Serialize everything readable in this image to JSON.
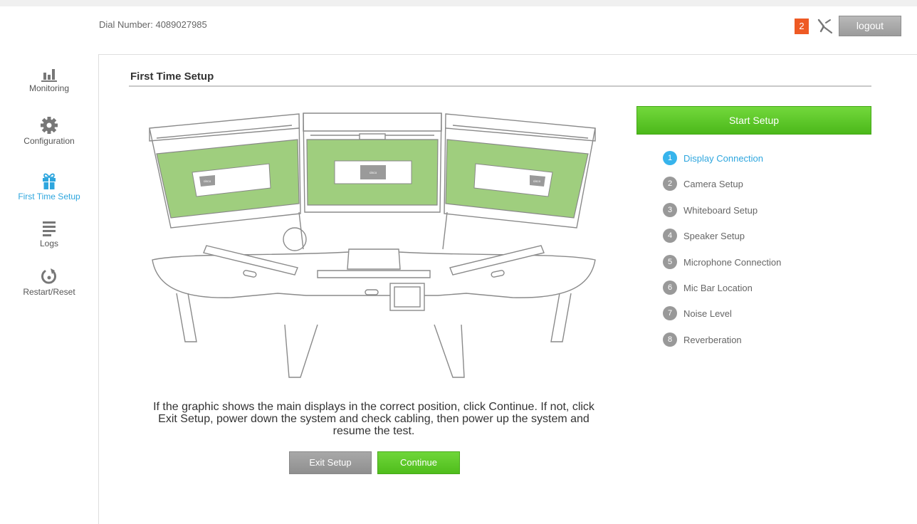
{
  "header": {
    "dial_number": "Dial Number: 4089027985",
    "notification_count": "2",
    "logout_label": "logout"
  },
  "sidebar": {
    "items": [
      {
        "label": "Monitoring",
        "icon": "bar-chart-icon"
      },
      {
        "label": "Configuration",
        "icon": "gear-icon"
      },
      {
        "label": "First Time Setup",
        "icon": "gift-icon",
        "active": true
      },
      {
        "label": "Logs",
        "icon": "list-icon"
      },
      {
        "label": "Restart/Reset",
        "icon": "power-icon"
      }
    ]
  },
  "main": {
    "title": "First Time Setup",
    "instruction": "If the graphic shows the main displays in the correct position, click Continue. If not, click Exit Setup, power down the system and check cabling, then power up the system and resume the test.",
    "exit_label": "Exit Setup",
    "continue_label": "Continue",
    "illustration_logo": "cisco"
  },
  "setup": {
    "start_label": "Start Setup",
    "steps": [
      {
        "num": "1",
        "label": "Display Connection",
        "active": true
      },
      {
        "num": "2",
        "label": "Camera Setup"
      },
      {
        "num": "3",
        "label": "Whiteboard Setup"
      },
      {
        "num": "4",
        "label": "Speaker Setup"
      },
      {
        "num": "5",
        "label": "Microphone Connection"
      },
      {
        "num": "6",
        "label": "Mic Bar Location"
      },
      {
        "num": "7",
        "label": "Noise Level"
      },
      {
        "num": "8",
        "label": "Reverberation"
      }
    ]
  },
  "colors": {
    "accent_blue": "#2ea6de",
    "action_green": "#5cc62a",
    "badge_orange": "#ee5a24",
    "display_green": "#9fce7e"
  }
}
